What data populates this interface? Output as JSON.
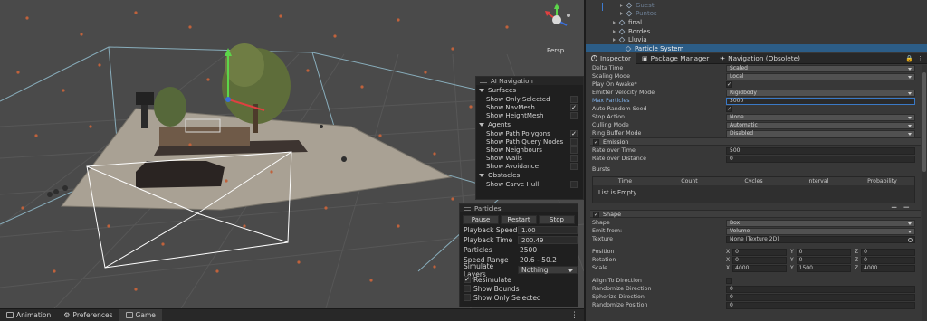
{
  "scene": {
    "view_mode": "Persp",
    "ai_navigation": {
      "title": "AI Navigation",
      "sections": [
        {
          "name": "Surfaces",
          "items": [
            {
              "label": "Show Only Selected",
              "checked": false
            },
            {
              "label": "Show NavMesh",
              "checked": true
            },
            {
              "label": "Show HeightMesh",
              "checked": false
            }
          ]
        },
        {
          "name": "Agents",
          "items": [
            {
              "label": "Show Path Polygons",
              "checked": true
            },
            {
              "label": "Show Path Query Nodes",
              "checked": false
            },
            {
              "label": "Show Neighbours",
              "checked": false
            },
            {
              "label": "Show Walls",
              "checked": false
            },
            {
              "label": "Show Avoidance",
              "checked": false
            }
          ]
        },
        {
          "name": "Obstacles",
          "items": [
            {
              "label": "Show Carve Hull",
              "checked": false
            }
          ]
        }
      ]
    },
    "particles_panel": {
      "title": "Particles",
      "buttons": [
        "Pause",
        "Restart",
        "Stop"
      ],
      "playback_speed_label": "Playback Speed",
      "playback_speed": "1.00",
      "playback_time_label": "Playback Time",
      "playback_time": "200.49",
      "particles_label": "Particles",
      "particles": "2500",
      "speed_range_label": "Speed Range",
      "speed_range": "20.6 - 50.2",
      "simulate_layers_label": "Simulate Layers",
      "simulate_layers": "Nothing",
      "resimulate_label": "Resimulate",
      "resimulate": true,
      "show_bounds_label": "Show Bounds",
      "show_bounds": false,
      "show_only_selected_label": "Show Only Selected",
      "show_only_selected": false
    }
  },
  "bottom_tabs": [
    {
      "label": "Animation",
      "icon": "animation-icon",
      "active": false
    },
    {
      "label": "Preferences",
      "icon": "gear-icon",
      "active": false
    },
    {
      "label": "Game",
      "icon": "game-icon",
      "active": true
    }
  ],
  "hierarchy": {
    "items": [
      {
        "label": "Guest",
        "indent": 3,
        "dim": true
      },
      {
        "label": "Puntos",
        "indent": 3,
        "dim": true
      },
      {
        "label": "final",
        "indent": 2,
        "dim": false
      },
      {
        "label": "Bordes",
        "indent": 2,
        "dim": false
      },
      {
        "label": "Lluvia",
        "indent": 2,
        "dim": false
      },
      {
        "label": "Particle System",
        "indent": 3,
        "dim": false,
        "selected": true
      }
    ]
  },
  "panel_tabs": [
    {
      "label": "Inspector",
      "icon": "info-icon",
      "active": true
    },
    {
      "label": "Package Manager",
      "icon": "package-icon",
      "active": false
    },
    {
      "label": "Navigation (Obsolete)",
      "icon": "navigation-icon",
      "active": false
    }
  ],
  "inspector": {
    "main_rows": [
      {
        "label": "Delta Time",
        "type": "dropdown",
        "value": "Scaled"
      },
      {
        "label": "Scaling Mode",
        "type": "dropdown",
        "value": "Local"
      },
      {
        "label": "Play On Awake*",
        "type": "check",
        "value": "✓"
      },
      {
        "label": "Emitter Velocity Mode",
        "type": "dropdown",
        "value": "Rigidbody"
      },
      {
        "label": "Max Particles",
        "type": "field",
        "value": "3000",
        "focus": true
      },
      {
        "label": "Auto Random Seed",
        "type": "check",
        "value": "✓"
      },
      {
        "label": "Stop Action",
        "type": "dropdown",
        "value": "None"
      },
      {
        "label": "Culling Mode",
        "type": "dropdown",
        "value": "Automatic"
      },
      {
        "label": "Ring Buffer Mode",
        "type": "dropdown",
        "value": "Disabled"
      }
    ],
    "emission": {
      "header": "Emission",
      "rows": [
        {
          "label": "Rate over Time",
          "value": "500"
        },
        {
          "label": "Rate over Distance",
          "value": "0"
        }
      ],
      "bursts_label": "Bursts",
      "bursts_columns": [
        "Time",
        "Count",
        "Cycles",
        "Interval",
        "Probability"
      ],
      "bursts_empty": "List is Empty"
    },
    "shape": {
      "header": "Shape",
      "shape_label": "Shape",
      "shape_value": "Box",
      "emit_from_label": "Emit from:",
      "emit_from_value": "Volume",
      "texture_label": "Texture",
      "texture_value": "None (Texture 2D)",
      "position_label": "Position",
      "position": [
        "0",
        "0",
        "0"
      ],
      "rotation_label": "Rotation",
      "rotation": [
        "0",
        "0",
        "0"
      ],
      "scale_label": "Scale",
      "scale": [
        "4000",
        "1500",
        "4000"
      ],
      "axes": [
        "X",
        "Y",
        "Z"
      ],
      "align_label": "Align To Direction",
      "randomize_dir_label": "Randomize Direction",
      "randomize_dir": "0",
      "spherize_label": "Spherize Direction",
      "spherize": "0",
      "randomize_pos_label": "Randomize Position",
      "randomize_pos": "0"
    }
  }
}
